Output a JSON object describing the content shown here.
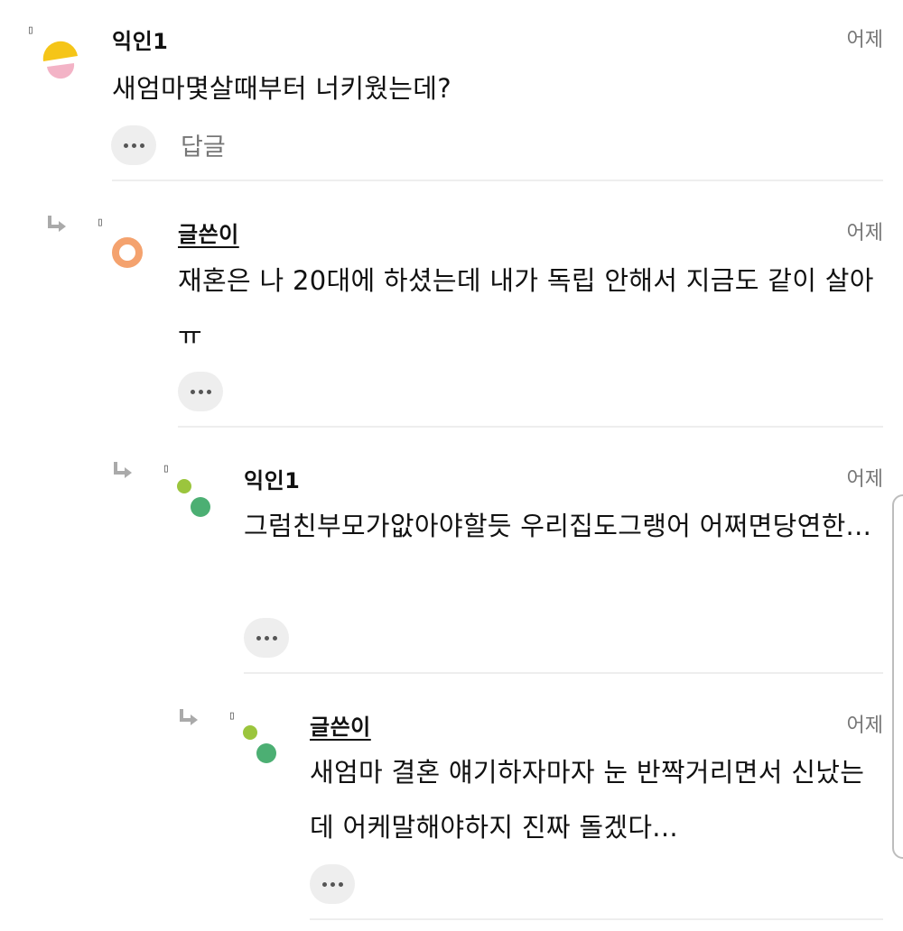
{
  "comments": [
    {
      "author": "익인1",
      "time": "어제",
      "text": "새엄마몇살때부터 너키웠는데?",
      "reply_label": "답글",
      "marker": "▯",
      "avatar": "yellow-pink-half-circles-avatar"
    },
    {
      "author": "글쓴이",
      "time": "어제",
      "text": "재혼은 나 20대에 하셨는데 내가 독립 안해서 지금도 같이 살아ㅠ",
      "marker": "▯",
      "avatar": "orange-ring-avatar"
    },
    {
      "author": "익인1",
      "time": "어제",
      "text": "그럼친부모가앖아야할듯 우리집도그랭어 어쩌면당연한...",
      "marker": "▯",
      "avatar": "green-dots-avatar"
    },
    {
      "author": "글쓴이",
      "time": "어제",
      "text": "새엄마 결혼 얘기하자마자 눈 반짝거리면서 신났는데 어케말해야하지 진짜 돌겠다...",
      "marker": "▯",
      "avatar": "green-dots-avatar"
    }
  ],
  "colors": {
    "avatar_yellow": "#f5c518",
    "avatar_pink": "#f3b3c6",
    "avatar_orange": "#f4a26e",
    "avatar_green_light": "#9bc53d",
    "avatar_green_dark": "#4caf73",
    "divider": "#eeeeee",
    "button_bg": "#eeeeee"
  }
}
